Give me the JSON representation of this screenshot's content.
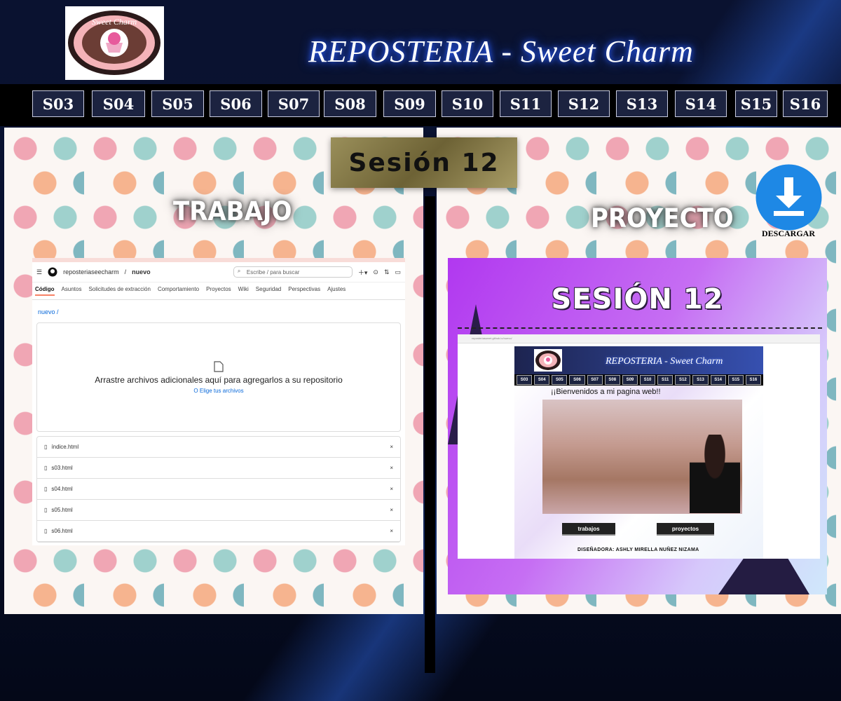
{
  "header": {
    "logo_text": "Sweet Charm",
    "title": "REPOSTERIA - Sweet Charm"
  },
  "nav": {
    "items": [
      "S03",
      "S04",
      "S05",
      "S06",
      "S07",
      "S08",
      "S09",
      "S10",
      "S11",
      "S12",
      "S13",
      "S14",
      "S15",
      "S16"
    ]
  },
  "session": {
    "label": "Sesión 12"
  },
  "left": {
    "heading": "TRABAJO",
    "github": {
      "repo": "reposteriaseecharm",
      "branch": "nuevo",
      "search_placeholder": "Escribe / para buscar",
      "tabs": [
        "Código",
        "Asuntos",
        "Solicitudes de extracción",
        "Comportamiento",
        "Proyectos",
        "Wiki",
        "Seguridad",
        "Perspectivas",
        "Ajustes"
      ],
      "path": "nuevo /",
      "drop_text": "Arrastre archivos adicionales aquí para agregarlos a su repositorio",
      "choose_text": "O Elige tus archivos",
      "files": [
        "índice.html",
        "s03.html",
        "s04.html",
        "s05.html",
        "s06.html"
      ],
      "remove_glyph": "×"
    }
  },
  "right": {
    "heading": "PROYECTO",
    "download_label": "DESCARGAR",
    "project": {
      "title": "SESIÓN 12",
      "url": "reposteriasweet.github.io/nuevo/",
      "mini_title": "REPOSTERIA - Sweet Charm",
      "mini_nav": [
        "S03",
        "S04",
        "S05",
        "S06",
        "S07",
        "S08",
        "S09",
        "S10",
        "S11",
        "S12",
        "S13",
        "S14",
        "S15",
        "S16"
      ],
      "welcome": "¡¡Bienvenidos a mi pagina web!!",
      "btn_trabajos": "trabajos",
      "btn_proyectos": "proyectos",
      "credit": "DISEÑADORA: ASHLY MIRELLA NUÑEZ NIZAMA"
    }
  },
  "colors": {
    "nav_bg": "#1c2340",
    "title_glow": "#2a5dff",
    "download_blue": "#1e88e5"
  }
}
